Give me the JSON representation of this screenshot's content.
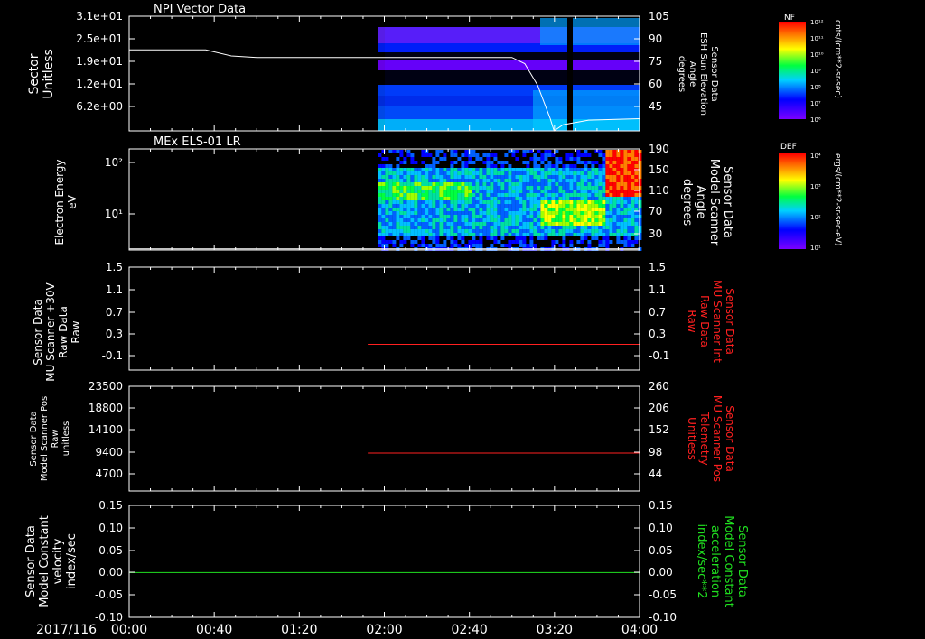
{
  "colors": {
    "background": "#000000",
    "axes": "#ffffff",
    "red_trace": "#ff2020",
    "green_trace": "#20e020",
    "white_trace": "#ffffff"
  },
  "time_axis": {
    "date_label": "2017/116",
    "ticks": [
      "00:00",
      "00:40",
      "01:20",
      "02:00",
      "02:40",
      "03:20",
      "04:00"
    ],
    "range_hours": [
      0,
      4
    ]
  },
  "chart_data": [
    {
      "id": "panel1",
      "type": "heatmap",
      "title": "NPI Vector Data",
      "ylabel_left": [
        "Sector",
        "Unitless"
      ],
      "ylabel_right": [
        "Sensor Data",
        "ESH Sun Elevation",
        "Angle",
        "degrees"
      ],
      "left_ticks": [
        "3.1e+01",
        "2.5e+01",
        "1.9e+01",
        "1.2e+01",
        "6.2e+00"
      ],
      "right_ticks": [
        "105",
        "90",
        "75",
        "60",
        "45"
      ],
      "left_range": [
        0,
        31
      ],
      "right_range": [
        30,
        105
      ],
      "data_start_hour": 1.95,
      "gap_hour": 3.38,
      "white_trace_right_axis": {
        "x_hours": [
          0,
          0.6,
          0.8,
          1.0,
          3.0,
          3.1,
          3.2,
          3.3,
          3.33,
          3.4,
          3.6,
          4.0
        ],
        "y": [
          83,
          83,
          79,
          78,
          78,
          74,
          60,
          38,
          30,
          34,
          37,
          38
        ]
      },
      "colorbar": {
        "label": "NF",
        "unit": "cnts/(cm**2-sr-sec)",
        "ticks": [
          "10¹²",
          "10¹¹",
          "10¹⁰",
          "10⁹",
          "10⁸",
          "10⁷",
          "10⁶"
        ]
      }
    },
    {
      "id": "panel2",
      "type": "heatmap",
      "title": "MEx ELS-01 LR",
      "ylabel_left": [
        "Electron Energy",
        "eV"
      ],
      "ylabel_right": [
        "Sensor Data",
        "Model Scanner",
        "Angle",
        "degrees"
      ],
      "left_ticks": [
        "10²",
        "10¹"
      ],
      "right_ticks": [
        "190",
        "150",
        "110",
        "70",
        "30"
      ],
      "right_range": [
        10,
        190
      ],
      "data_start_hour": 1.95,
      "white_trace_right_axis": {
        "x_hours": [
          0,
          4
        ],
        "y": [
          12,
          12
        ]
      },
      "colorbar": {
        "label": "DEF",
        "unit": "ergs/(cm**2-sr-sec-eV)",
        "ticks": [
          "10⁴",
          "10³",
          "10²",
          "10¹"
        ]
      }
    },
    {
      "id": "panel3",
      "type": "line",
      "ylabel_left": [
        "Sensor Data",
        "MU Scanner +30V",
        "Raw Data",
        "Raw"
      ],
      "ylabel_right": [
        "Sensor Data",
        "MU Scanner Int",
        "Raw Data",
        "Raw"
      ],
      "left_ticks": [
        "1.5",
        "1.1",
        "0.7",
        "0.3",
        "-0.1"
      ],
      "right_ticks": [
        "1.5",
        "1.1",
        "0.7",
        "0.3",
        "-0.1"
      ],
      "ylim": [
        -0.5,
        1.5
      ],
      "series": [
        {
          "x_hours": [
            1.87,
            4.0
          ],
          "y": [
            0.0,
            0.0
          ]
        }
      ]
    },
    {
      "id": "panel4",
      "type": "line",
      "ylabel_left": [
        "Sensor Data",
        "Model Scanner Pos",
        "Raw",
        "unitless"
      ],
      "ylabel_right": [
        "Sensor Data",
        "MU Scanner Pos",
        "Telemetry",
        "Unitless"
      ],
      "left_ticks": [
        "23500",
        "18800",
        "14100",
        "9400",
        "4700"
      ],
      "right_ticks": [
        "260",
        "206",
        "152",
        "98",
        "44"
      ],
      "ylim": [
        0,
        23500
      ],
      "series": [
        {
          "x_hours": [
            1.87,
            4.0
          ],
          "y": [
            8500,
            8500
          ]
        }
      ]
    },
    {
      "id": "panel5",
      "type": "line",
      "ylabel_left": [
        "Sensor Data",
        "Model Constant",
        "velocity",
        "index/sec"
      ],
      "ylabel_right": [
        "Sensor Data",
        "Model Constant",
        "acceleration",
        "index/sec**2"
      ],
      "left_ticks": [
        "0.15",
        "0.10",
        "0.05",
        "0.00",
        "-0.05",
        "-0.10"
      ],
      "right_ticks": [
        "0.15",
        "0.10",
        "0.05",
        "0.00",
        "-0.05",
        "-0.10"
      ],
      "ylim": [
        -0.1,
        0.15
      ],
      "series": [
        {
          "x_hours": [
            0,
            4.0
          ],
          "y": [
            0.0,
            0.0
          ]
        }
      ]
    }
  ]
}
